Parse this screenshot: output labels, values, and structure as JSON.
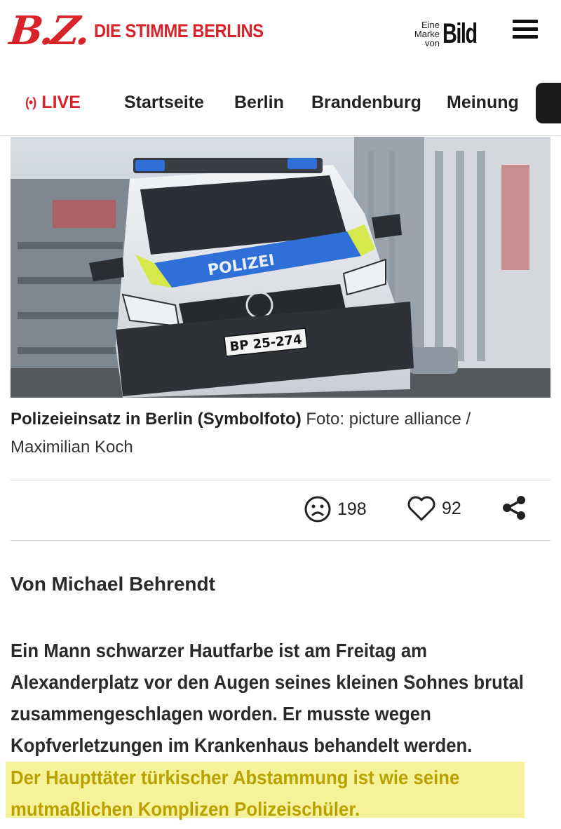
{
  "header": {
    "logo_text": "B.Z.",
    "claim": "DIE STIMME BERLINS",
    "brand_line1": "Eine",
    "brand_line2": "Marke",
    "brand_line3": "von",
    "brand_name": "Bild"
  },
  "nav": {
    "live_label": "LIVE",
    "items": [
      "Startseite",
      "Berlin",
      "Brandenburg",
      "Meinung"
    ]
  },
  "image": {
    "license_plate": "BP 25-274",
    "vehicle_label": "POLIZEI"
  },
  "caption": {
    "title": "Polizeieinsatz in Berlin (Symbolfoto)",
    "credit": "Foto: picture alliance / Maximilian Koch"
  },
  "reactions": {
    "sad_count": "198",
    "like_count": "92"
  },
  "article": {
    "author": "Von Michael Behrendt",
    "paragraph": "Ein Mann schwarzer Hautfarbe ist am Freitag am Alexanderplatz vor den Augen seines kleinen Sohnes brutal zusammengeschlagen worden. Er musste wegen Kopfverletzungen im Krankenhaus behandelt werden.",
    "highlighted": "Der Haupttäter türkischer Abstammung ist wie seine mutmaßlichen Komplizen Polizeischüler."
  },
  "colors": {
    "brand_red": "#d8232a",
    "highlight": "#f6f29a",
    "highlight_text": "#b8a100"
  }
}
